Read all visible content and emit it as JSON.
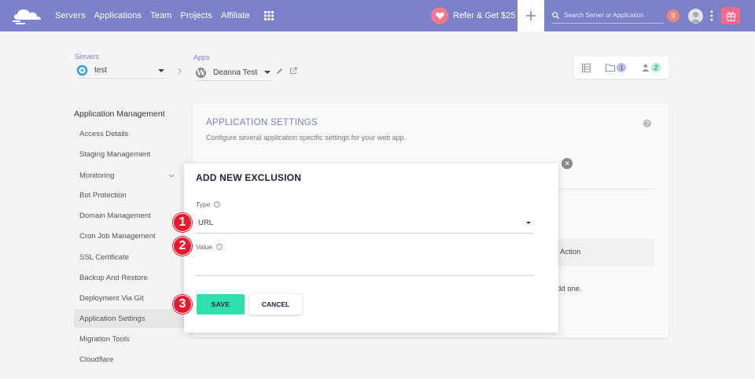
{
  "nav": {
    "items": [
      "Servers",
      "Applications",
      "Team",
      "Projects",
      "Affiliate"
    ],
    "refer_label": "Refer & Get $25",
    "search_placeholder": "Search Server or Application",
    "notification_count": "9"
  },
  "breadcrumb": {
    "servers_label": "Servers",
    "server_value": "test",
    "apps_label": "Apps",
    "app_value": "Deanna Test"
  },
  "counts": {
    "files": "1",
    "users": "2"
  },
  "sidebar": {
    "title": "Application Management",
    "items": [
      "Access Details",
      "Staging Management",
      "Monitoring",
      "Bot Protection",
      "Domain Management",
      "Cron Job Management",
      "SSL Certificate",
      "Backup And Restore",
      "Deployment Via Git",
      "Application Settings",
      "Migration Tools",
      "Cloudflare"
    ],
    "active": "Application Settings"
  },
  "card": {
    "title": "APPLICATION SETTINGS",
    "subtitle": "Configure several application specific settings for your web app.",
    "bg_action": "Action",
    "bg_text": "dd one."
  },
  "modal": {
    "title": "ADD NEW EXCLUSION",
    "type_label": "Type",
    "type_value": "URL",
    "value_label": "Value",
    "save_label": "SAVE",
    "cancel_label": "CANCEL"
  },
  "markers": [
    "1",
    "2",
    "3"
  ],
  "colors": {
    "nav": "#7b82c9",
    "accent": "#2de0ad",
    "heading": "#7b82c9",
    "marker": "#e8192c"
  }
}
